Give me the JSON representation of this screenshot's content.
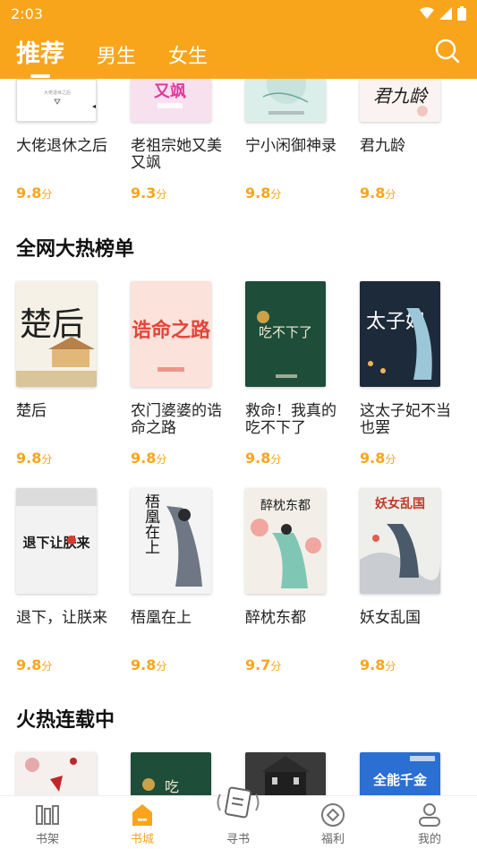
{
  "status": {
    "time": "2:03"
  },
  "tabs": [
    {
      "label": "推荐"
    },
    {
      "label": "男生"
    },
    {
      "label": "女生"
    }
  ],
  "sections": {
    "hot_list": {
      "title": "全网大热榜单"
    },
    "serial": {
      "title": "火热连载中"
    }
  },
  "rating_unit": "分",
  "rows": [
    [
      {
        "title": "大佬退休之后",
        "rating": "9.8"
      },
      {
        "title": "老祖宗她又美又飒",
        "rating": "9.3"
      },
      {
        "title": "宁小闲御神录",
        "rating": "9.8"
      },
      {
        "title": "君九龄",
        "rating": "9.8"
      }
    ],
    [
      {
        "title": "楚后",
        "rating": "9.8"
      },
      {
        "title": "农门婆婆的诰命之路",
        "rating": "9.8"
      },
      {
        "title": "救命！我真的吃不下了",
        "rating": "9.8"
      },
      {
        "title": "这太子妃不当也罢",
        "rating": "9.8"
      }
    ],
    [
      {
        "title": "退下，让朕来",
        "rating": "9.8"
      },
      {
        "title": "梧凰在上",
        "rating": "9.8"
      },
      {
        "title": "醉枕东都",
        "rating": "9.7"
      },
      {
        "title": "妖女乱国",
        "rating": "9.8"
      }
    ]
  ],
  "covers": {
    "row0": [
      "大佬退休之后",
      "又飒",
      "",
      "君九龄"
    ],
    "row1": [
      "楚后",
      "诰命之路",
      "吃不下了",
      "太子妃"
    ],
    "row2": [
      "退下让朕来",
      "梧凰在上",
      "醉枕东都",
      "妖女乱国"
    ],
    "row3": [
      "",
      "吃",
      "",
      "全能千金"
    ]
  },
  "nav": [
    {
      "label": "书架",
      "icon": "bookshelf-icon"
    },
    {
      "label": "书城",
      "icon": "bookstore-icon"
    },
    {
      "label": "寻书",
      "icon": "find-book-icon"
    },
    {
      "label": "福利",
      "icon": "welfare-icon"
    },
    {
      "label": "我的",
      "icon": "profile-icon"
    }
  ],
  "colors": {
    "accent": "#F9A51C"
  }
}
